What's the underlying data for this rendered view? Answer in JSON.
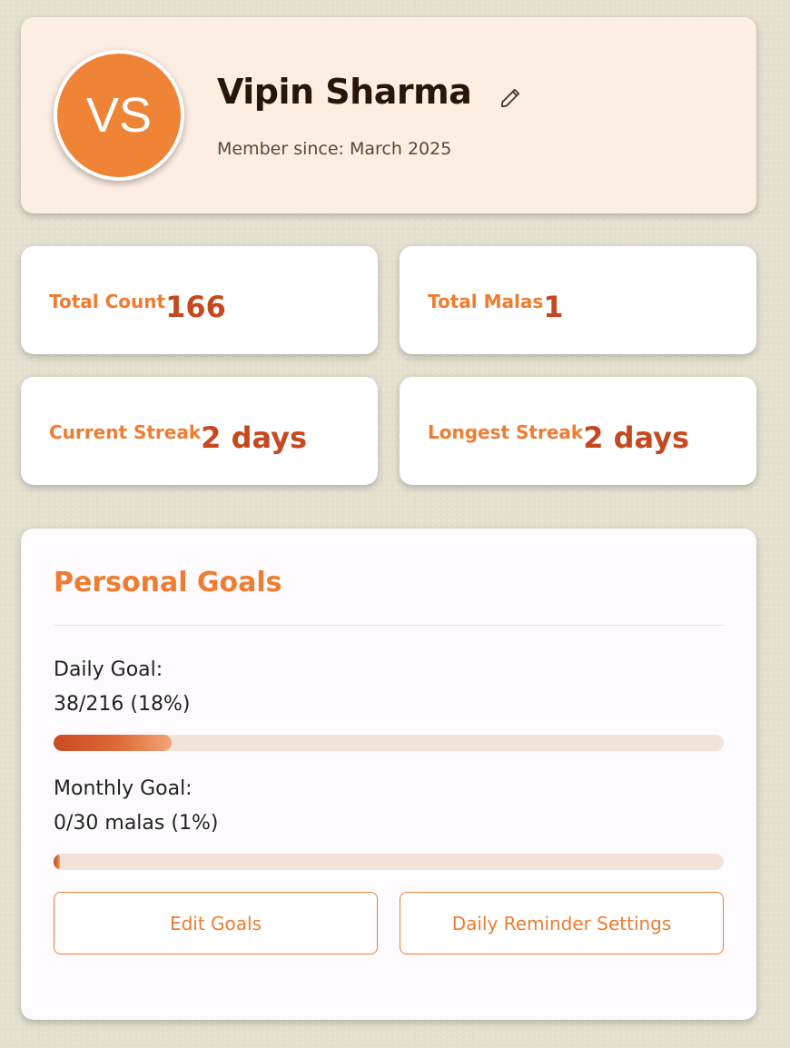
{
  "profile": {
    "initials": "VS",
    "name": "Vipin Sharma",
    "member_since": "Member since: March 2025"
  },
  "stats": {
    "total_count": {
      "label": "Total Count",
      "value": "166"
    },
    "total_malas": {
      "label": "Total Malas",
      "value": "1"
    },
    "current_streak": {
      "label": "Current Streak",
      "value": "2 days"
    },
    "longest_streak": {
      "label": "Longest Streak",
      "value": "2 days"
    }
  },
  "goals": {
    "title": "Personal Goals",
    "daily": {
      "label": "Daily Goal:",
      "value": "38/216 (18%)",
      "progress_fraction": 0.176
    },
    "monthly": {
      "label": "Monthly Goal:",
      "value": "0/30 malas (1%)",
      "progress_fraction": 0.01
    },
    "edit_button": "Edit Goals",
    "reminder_button": "Daily Reminder Settings"
  },
  "colors": {
    "accent": "#ef7c30",
    "value": "#c6481e",
    "avatar": "#f08436",
    "profile_bg": "#fdeee4"
  },
  "icons": {
    "edit": "pencil-icon"
  }
}
